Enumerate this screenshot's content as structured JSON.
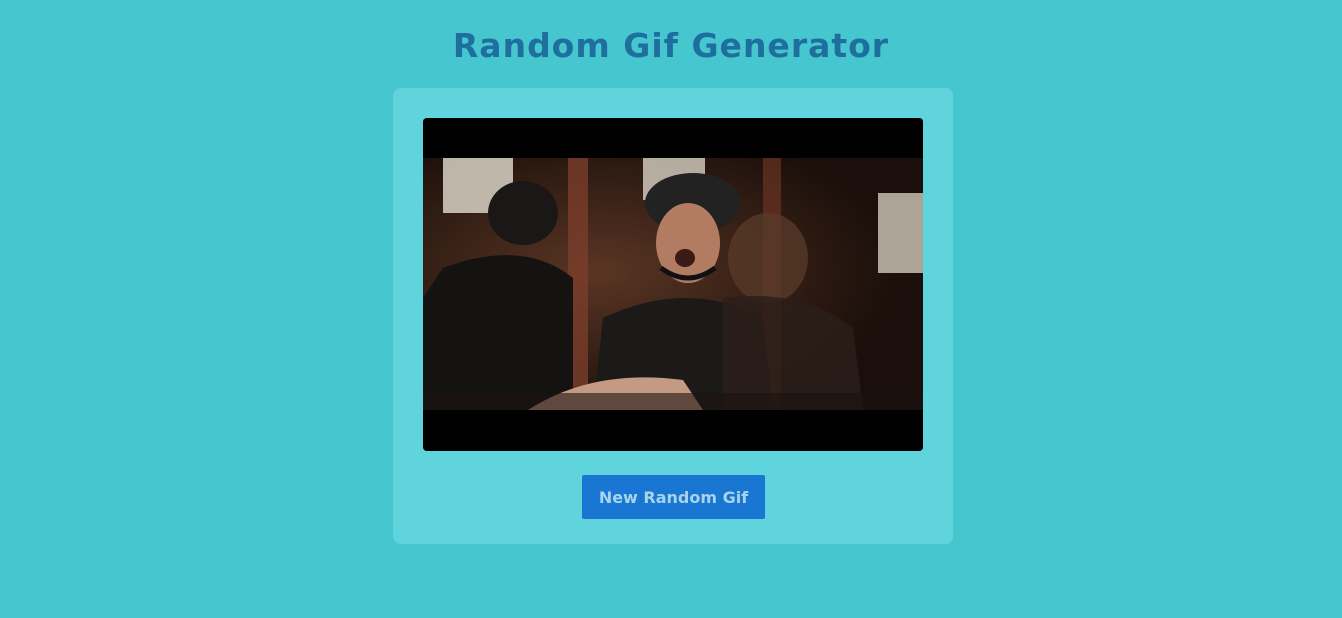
{
  "page": {
    "title": "Random Gif Generator"
  },
  "gif": {
    "alt": "Random gif"
  },
  "button": {
    "label": "New Random Gif"
  },
  "colors": {
    "background": "#46c6cf",
    "card": "#5fd4dd",
    "title": "#1e6f9e",
    "button": "#1976d2",
    "button_text": "#a7d3ec"
  }
}
